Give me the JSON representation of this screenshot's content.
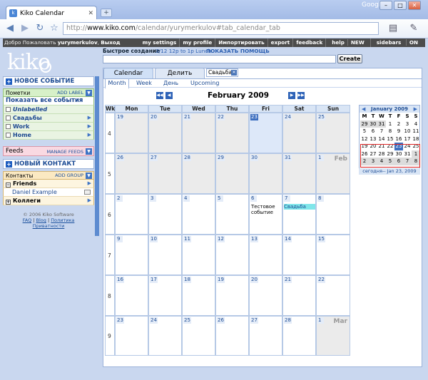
{
  "browser": {
    "tab_title": "Kiko Calendar",
    "new_tab": "+",
    "google": "Google",
    "url_host": "www.kiko.com",
    "url_path": "/calendar/yurymerkulov#tab_calendar_tab",
    "url_scheme": "http://"
  },
  "topbar": {
    "greeting_prefix": "Добро Пожаловать",
    "user": "yurymerkulov",
    "logout": "Выход",
    "links": [
      "my settings",
      "my profile",
      "Импортировать",
      "export",
      "feedback",
      "help"
    ],
    "sidebars_label": "sidebars",
    "sidebars_state": "ON",
    "new_badge": "NEW"
  },
  "quick_create": {
    "label": "Быстрое создание",
    "hint": "3/12 12p to 1p Lunch",
    "help": "ПОКАЗАТЬ ПОМОЩЬ",
    "button": "Create"
  },
  "logo": "kiko",
  "sidebar": {
    "new_event": "НОВОЕ СОБЫТИЕ",
    "labels_title": "Пометки",
    "add_label": "ADD LABEL",
    "show_all": "Показать все события",
    "items": [
      {
        "name": "Unlabelled"
      },
      {
        "name": "Свадьбы"
      },
      {
        "name": "Work"
      },
      {
        "name": "Home"
      }
    ],
    "feeds_title": "Feeds",
    "manage_feeds": "MANAGE FEEDS",
    "new_contact": "НОВЫЙ КОНТАКТ",
    "contacts_title": "Контакты",
    "add_group": "ADD GROUP",
    "groups": [
      {
        "name": "Friends",
        "sign": "−"
      },
      {
        "name": "Daniel Example",
        "sign": ""
      },
      {
        "name": "Коллеги",
        "sign": "+"
      }
    ],
    "footer_copy": "© 2006 Kiko Software",
    "footer_links": [
      "FAQ",
      "Blog",
      "Политика",
      "Приватности"
    ]
  },
  "main": {
    "tabs": [
      "Calendar",
      "Делить"
    ],
    "open_tab": "Свадьба",
    "views": [
      "Month",
      "Week",
      "День",
      "Upcoming"
    ],
    "month_title": "February 2009",
    "weekday_headers": [
      "Wk",
      "Mon",
      "Tue",
      "Wed",
      "Thu",
      "Fri",
      "Sat",
      "Sun"
    ],
    "weeks": [
      "4",
      "5",
      "6",
      "7",
      "8",
      "9"
    ],
    "rows": [
      [
        "19",
        "20",
        "21",
        "22",
        "23",
        "24",
        "25"
      ],
      [
        "26",
        "27",
        "28",
        "29",
        "30",
        "31",
        "1"
      ],
      [
        "2",
        "3",
        "4",
        "5",
        "6",
        "7",
        "8"
      ],
      [
        "9",
        "10",
        "11",
        "12",
        "13",
        "14",
        "15"
      ],
      [
        "16",
        "17",
        "18",
        "19",
        "20",
        "21",
        "22"
      ],
      [
        "23",
        "24",
        "25",
        "26",
        "27",
        "28",
        "1"
      ]
    ],
    "month_labels": {
      "feb": "Feb",
      "mar": "Mar"
    },
    "events": {
      "fri_6": "Тестовое событие",
      "sat_7": "Свадьба"
    }
  },
  "mini": {
    "title": "January 2009",
    "heads": [
      "M",
      "T",
      "W",
      "T",
      "F",
      "S",
      "S"
    ],
    "rows": [
      [
        "29",
        "30",
        "31",
        "1",
        "2",
        "3",
        "4"
      ],
      [
        "5",
        "6",
        "7",
        "8",
        "9",
        "10",
        "11"
      ],
      [
        "12",
        "13",
        "14",
        "15",
        "16",
        "17",
        "18"
      ],
      [
        "19",
        "20",
        "21",
        "22",
        "23",
        "24",
        "25"
      ],
      [
        "26",
        "27",
        "28",
        "29",
        "30",
        "31",
        "1"
      ],
      [
        "2",
        "3",
        "4",
        "5",
        "6",
        "7",
        "8"
      ]
    ],
    "today_link": "сегодня-- Jan 23, 2009"
  }
}
